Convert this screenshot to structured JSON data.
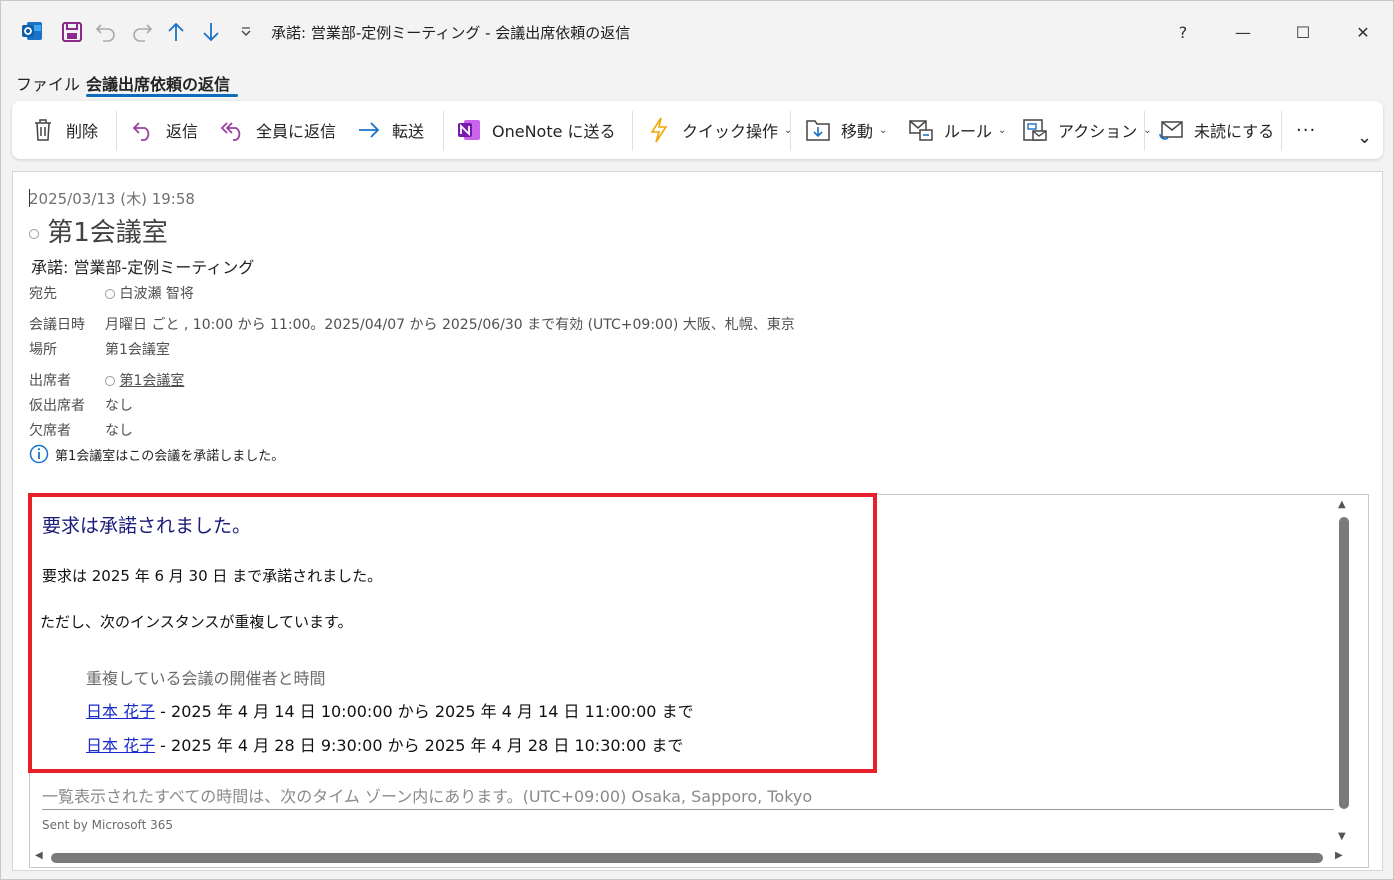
{
  "window": {
    "title": "承諾: 営業部-定例ミーティング  -  会議出席依頼の返信",
    "help_label": "?",
    "minimize_glyph": "—",
    "maximize_glyph": "☐",
    "close_glyph": "✕"
  },
  "tabs": [
    {
      "label": "ファイル"
    },
    {
      "label": "会議出席依頼の返信"
    }
  ],
  "ribbon": {
    "delete": "削除",
    "reply": "返信",
    "reply_all": "全員に返信",
    "forward": "転送",
    "onenote": "OneNote に送る",
    "quick_steps": "クイック操作",
    "move": "移動",
    "rules": "ルール",
    "actions": "アクション",
    "mark_unread": "未読にする",
    "more": "···",
    "expand": "⌄"
  },
  "message": {
    "date": "2025/03/13 (木) 19:58",
    "from_name": "第1会議室",
    "subject": "承諾: 営業部-定例ミーティング",
    "to_label": "宛先",
    "to_value": "白波瀬 智将",
    "when_label": "会議日時",
    "when_value": "月曜日 ごと , 10:00 から 11:00。2025/04/07 から 2025/06/30 まで有効 (UTC+09:00) 大阪、札幌、東京",
    "location_label": "場所",
    "location_value": "第1会議室",
    "attendees_label": "出席者",
    "attendees_value": "第1会議室",
    "tentative_label": "仮出席者",
    "tentative_value": "なし",
    "declined_label": "欠席者",
    "declined_value": "なし",
    "info_text": "第1会議室はこの会議を承諾しました。"
  },
  "body": {
    "heading": "要求は承諾されました。",
    "line1": "要求は 2025 年 6 月 30 日 まで承諾されました。",
    "line2": "ただし、次のインスタンスが重複しています。",
    "conflict_heading": "重複している会議の開催者と時間",
    "conflicts": [
      {
        "organizer": "日本 花子",
        "time": " - 2025 年 4 月 14 日 10:00:00 から 2025 年 4 月 14 日 11:00:00 まで"
      },
      {
        "organizer": "日本 花子",
        "time": " - 2025 年 4 月 28 日 9:30:00 から 2025 年 4 月 28 日 10:30:00 まで"
      }
    ],
    "timezone_note": "一覧表示されたすべての時間は、次のタイム ゾーン内にあります。(UTC+09:00) Osaka, Sapporo, Tokyo",
    "sent_by": "Sent by Microsoft 365"
  },
  "colors": {
    "accent": "#0f6cbd",
    "highlight_border": "#e8202b",
    "link": "#1a2bcc",
    "body_heading": "#1b1b7a"
  }
}
